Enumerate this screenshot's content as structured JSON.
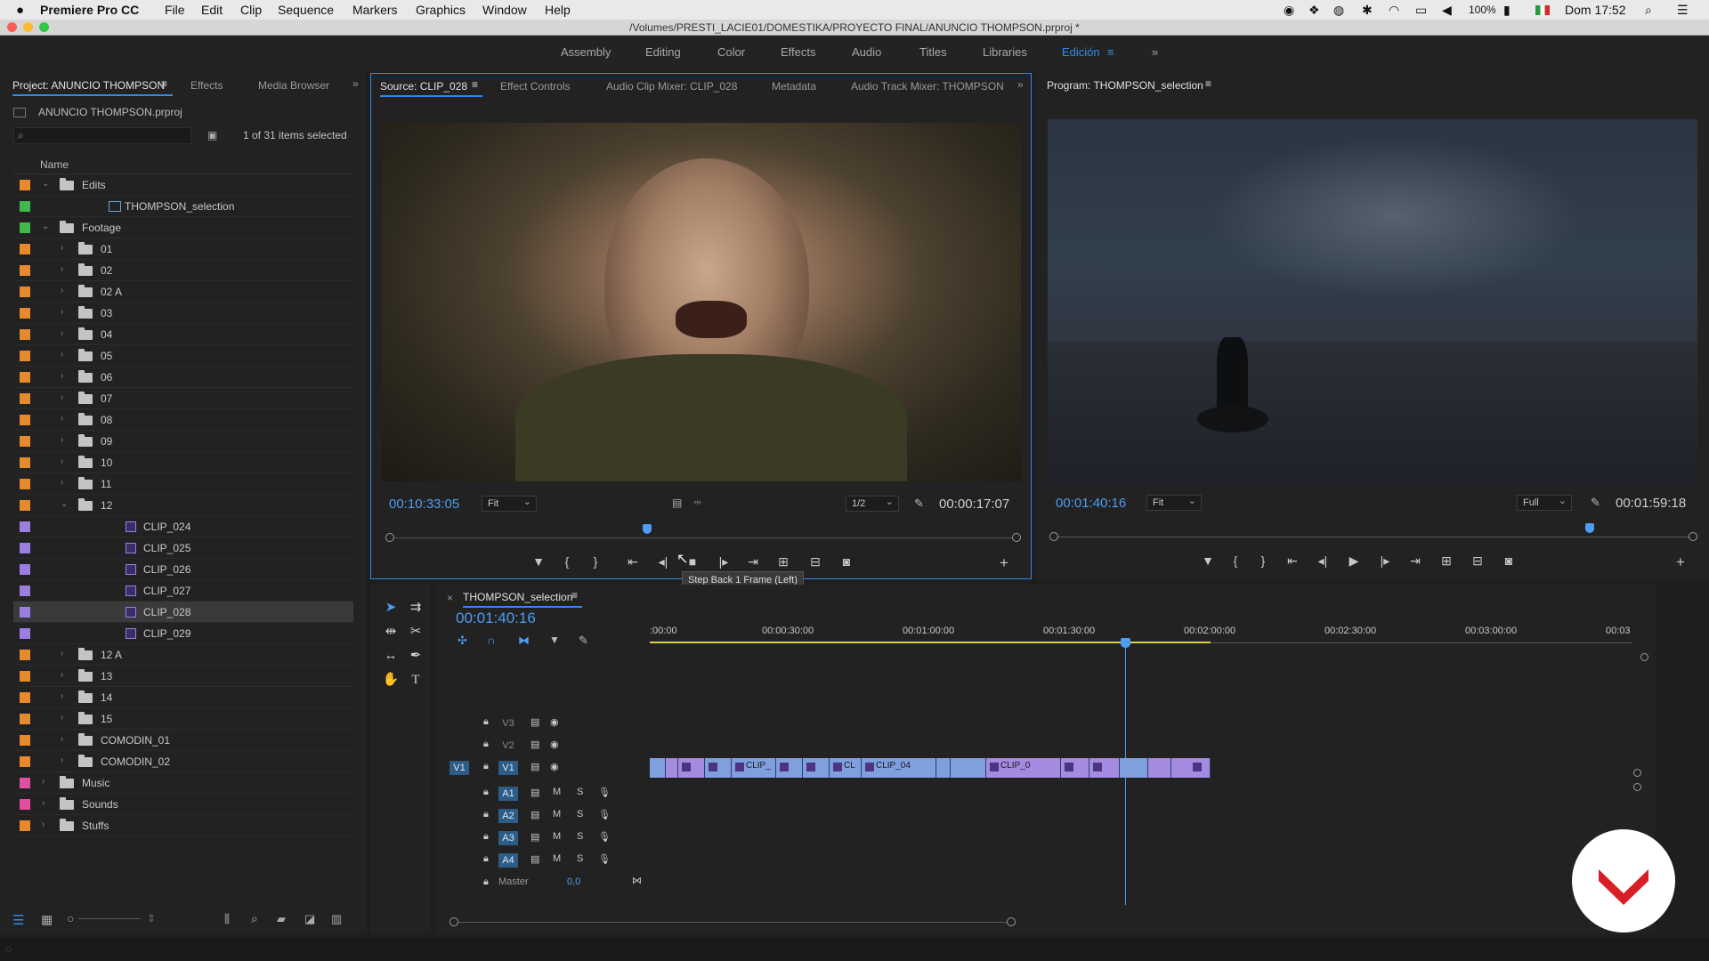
{
  "menubar": {
    "app": "Premiere Pro CC",
    "items": [
      "File",
      "Edit",
      "Clip",
      "Sequence",
      "Markers",
      "Graphics",
      "Window",
      "Help"
    ],
    "battery": "100%",
    "clock": "Dom 17:52"
  },
  "window": {
    "title": "/Volumes/PRESTI_LACIE01/DOMESTIKA/PROYECTO FINAL/ANUNCIO THOMPSON.prproj *"
  },
  "workspaces": {
    "items": [
      "Assembly",
      "Editing",
      "Color",
      "Effects",
      "Audio",
      "Titles",
      "Libraries",
      "Edición"
    ],
    "active": "Edición",
    "accent": "#2d8ceb"
  },
  "project": {
    "tabs": [
      "Project: ANUNCIO THOMPSON",
      "Effects",
      "Media Browser"
    ],
    "file": "ANUNCIO THOMPSON.prproj",
    "selection": "1 of 31 items selected",
    "column": "Name",
    "items": [
      {
        "label": "Edits",
        "color": "#e78a2d",
        "indent": 0,
        "type": "folder",
        "open": true
      },
      {
        "label": "THOMPSON_selection",
        "color": "#3fb84c",
        "indent": 1,
        "type": "sequence"
      },
      {
        "label": "Footage",
        "color": "#3fb84c",
        "indent": 0,
        "type": "folder",
        "open": true
      },
      {
        "label": "01",
        "color": "#e78a2d",
        "indent": 1,
        "type": "folder"
      },
      {
        "label": "02",
        "color": "#e78a2d",
        "indent": 1,
        "type": "folder"
      },
      {
        "label": "02 A",
        "color": "#e78a2d",
        "indent": 1,
        "type": "folder"
      },
      {
        "label": "03",
        "color": "#e78a2d",
        "indent": 1,
        "type": "folder"
      },
      {
        "label": "04",
        "color": "#e78a2d",
        "indent": 1,
        "type": "folder"
      },
      {
        "label": "05",
        "color": "#e78a2d",
        "indent": 1,
        "type": "folder"
      },
      {
        "label": "06",
        "color": "#e78a2d",
        "indent": 1,
        "type": "folder"
      },
      {
        "label": "07",
        "color": "#e78a2d",
        "indent": 1,
        "type": "folder"
      },
      {
        "label": "08",
        "color": "#e78a2d",
        "indent": 1,
        "type": "folder"
      },
      {
        "label": "09",
        "color": "#e78a2d",
        "indent": 1,
        "type": "folder"
      },
      {
        "label": "10",
        "color": "#e78a2d",
        "indent": 1,
        "type": "folder"
      },
      {
        "label": "11",
        "color": "#e78a2d",
        "indent": 1,
        "type": "folder"
      },
      {
        "label": "12",
        "color": "#e78a2d",
        "indent": 1,
        "type": "folder",
        "open": true
      },
      {
        "label": "CLIP_024",
        "color": "#9b7fe0",
        "indent": 2,
        "type": "clip"
      },
      {
        "label": "CLIP_025",
        "color": "#9b7fe0",
        "indent": 2,
        "type": "clip"
      },
      {
        "label": "CLIP_026",
        "color": "#9b7fe0",
        "indent": 2,
        "type": "clip"
      },
      {
        "label": "CLIP_027",
        "color": "#9b7fe0",
        "indent": 2,
        "type": "clip"
      },
      {
        "label": "CLIP_028",
        "color": "#9b7fe0",
        "indent": 2,
        "type": "clip",
        "selected": true
      },
      {
        "label": "CLIP_029",
        "color": "#9b7fe0",
        "indent": 2,
        "type": "clip"
      },
      {
        "label": "12 A",
        "color": "#e78a2d",
        "indent": 1,
        "type": "folder"
      },
      {
        "label": "13",
        "color": "#e78a2d",
        "indent": 1,
        "type": "folder"
      },
      {
        "label": "14",
        "color": "#e78a2d",
        "indent": 1,
        "type": "folder"
      },
      {
        "label": "15",
        "color": "#e78a2d",
        "indent": 1,
        "type": "folder"
      },
      {
        "label": "COMODIN_01",
        "color": "#e78a2d",
        "indent": 1,
        "type": "folder"
      },
      {
        "label": "COMODIN_02",
        "color": "#e78a2d",
        "indent": 1,
        "type": "folder"
      },
      {
        "label": "Music",
        "color": "#e04fa0",
        "indent": 0,
        "type": "folder"
      },
      {
        "label": "Sounds",
        "color": "#e04fa0",
        "indent": 0,
        "type": "folder"
      },
      {
        "label": "Stuffs",
        "color": "#e78a2d",
        "indent": 0,
        "type": "folder"
      }
    ]
  },
  "source": {
    "tabs": [
      "Source: CLIP_028",
      "Effect Controls",
      "Audio Clip Mixer: CLIP_028",
      "Metadata",
      "Audio Track Mixer: THOMPSON"
    ],
    "timecode": "00:10:33:05",
    "fit": "Fit",
    "resolution": "1/2",
    "duration": "00:00:17:07",
    "playhead_fraction": 0.41,
    "tooltip": "Step Back 1 Frame (Left)"
  },
  "program": {
    "title": "Program: THOMPSON_selection",
    "timecode": "00:01:40:16",
    "fit": "Fit",
    "resolution": "Full",
    "duration": "00:01:59:18",
    "playhead_fraction": 0.84
  },
  "timeline": {
    "title": "THOMPSON_selection",
    "timecode": "00:01:40:16",
    "ticks": [
      ":00:00",
      "00:00:30:00",
      "00:01:00:00",
      "00:01:30:00",
      "00:02:00:00",
      "00:02:30:00",
      "00:03:00:00",
      "00:03"
    ],
    "video_tracks": [
      "V3",
      "V2",
      "V1"
    ],
    "audio_tracks": [
      "A1",
      "A2",
      "A3",
      "A4"
    ],
    "mute": "M",
    "solo": "S",
    "master_label": "Master",
    "master_value": "0,0",
    "clips": [
      {
        "label": "CLIP_",
        "color": "#7f9fde"
      },
      {
        "label": "CL",
        "color": "#7f9fde"
      },
      {
        "label": "CLIP_04",
        "color": "#7f9fde"
      },
      {
        "label": "CLIP_0",
        "color": "#a48ae0"
      }
    ]
  }
}
